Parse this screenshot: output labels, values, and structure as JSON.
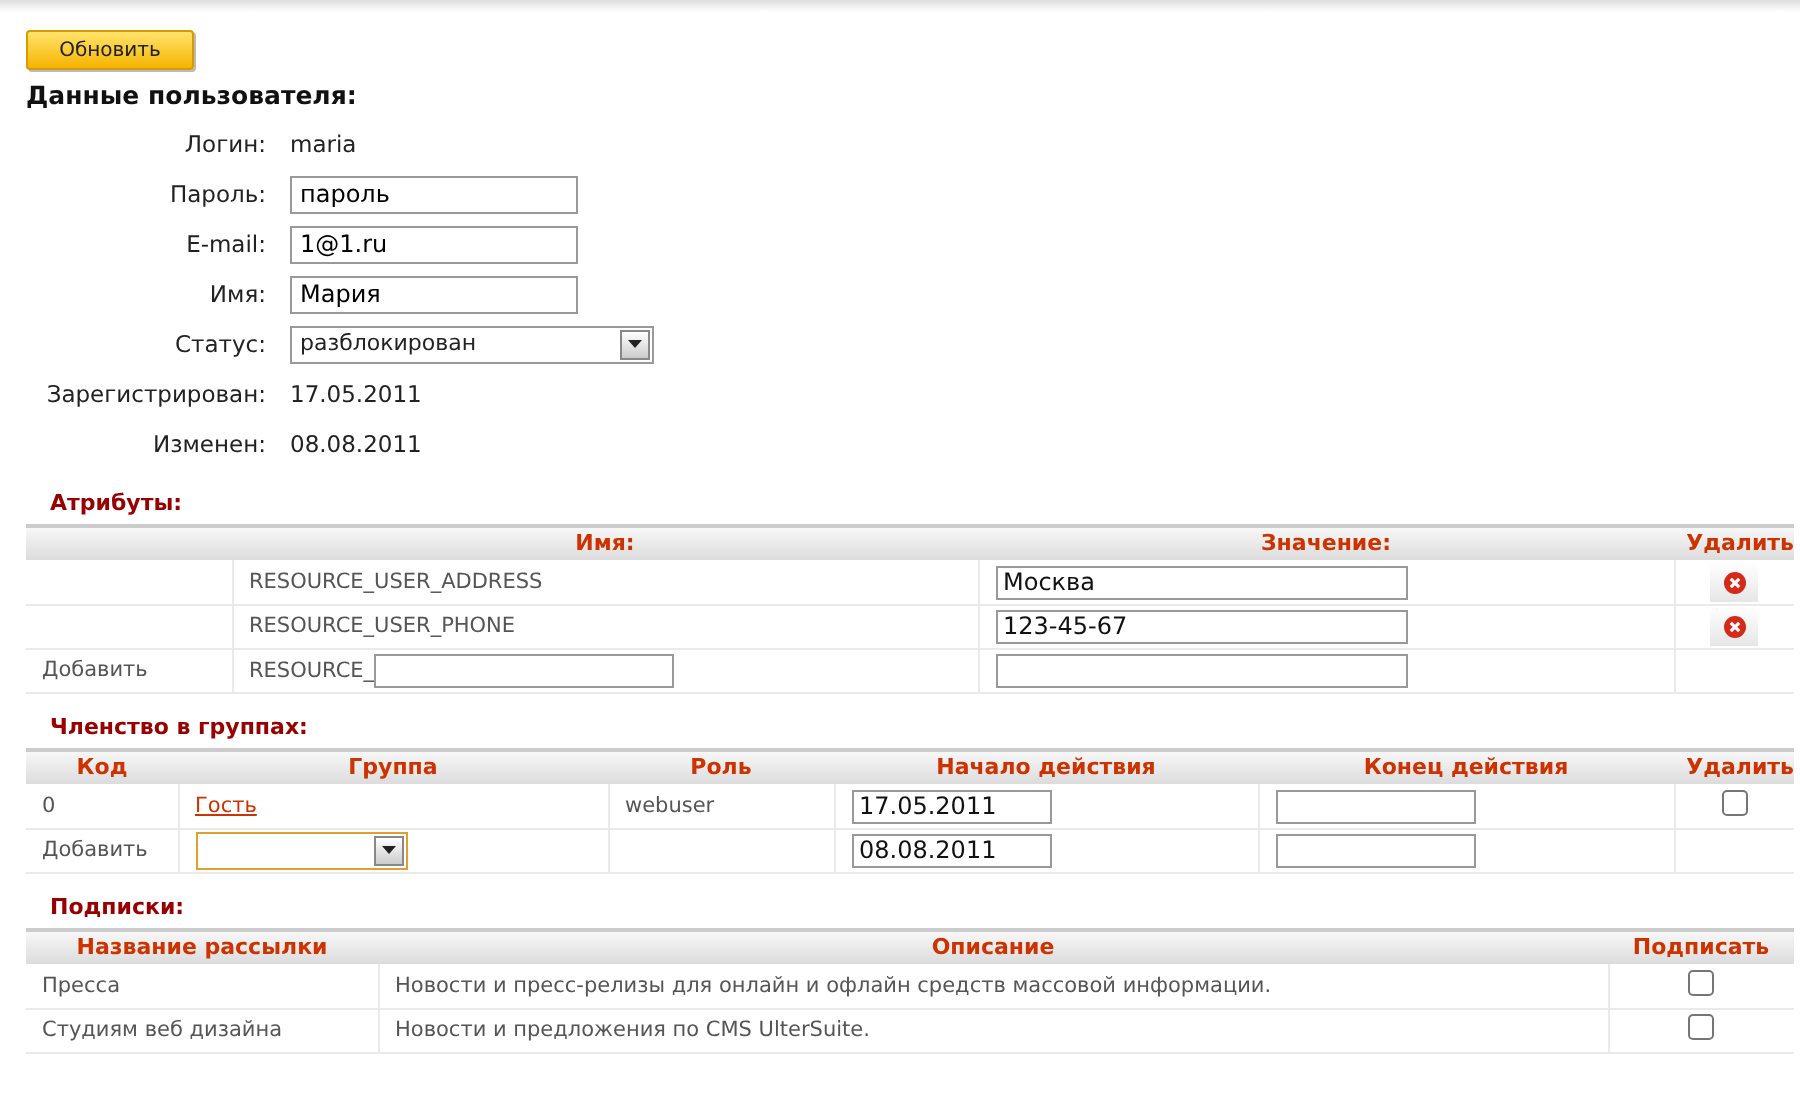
{
  "refresh_button": "Обновить",
  "user_section": {
    "title": "Данные пользователя:",
    "fields": [
      {
        "kind": "text",
        "label": "Логин:",
        "value": "maria"
      },
      {
        "kind": "input",
        "label": "Пароль:",
        "value": "пароль"
      },
      {
        "kind": "input",
        "label": "E-mail:",
        "value": "1@1.ru"
      },
      {
        "kind": "input",
        "label": "Имя:",
        "value": "Мария"
      },
      {
        "kind": "select",
        "label": "Статус:",
        "value": "разблокирован"
      },
      {
        "kind": "text",
        "label": "Зарегистрирован:",
        "value": "17.05.2011"
      },
      {
        "kind": "text",
        "label": "Изменен:",
        "value": "08.08.2011"
      }
    ]
  },
  "attributes": {
    "title": "Атрибуты:",
    "columns": [
      "Имя:",
      "Значение:",
      "Удалить"
    ],
    "rows": [
      {
        "name": "RESOURCE_USER_ADDRESS",
        "value": "Москва"
      },
      {
        "name": "RESOURCE_USER_PHONE",
        "value": "123-45-67"
      }
    ],
    "add_row": {
      "label": "Добавить",
      "prefix": "RESOURCE_"
    }
  },
  "groups": {
    "title": "Членство в группах:",
    "columns": [
      "Код",
      "Группа",
      "Роль",
      "Начало действия",
      "Конец действия",
      "Удалить"
    ],
    "rows": [
      {
        "code": "0",
        "group": "Гость",
        "role": "webuser",
        "start": "17.05.2011",
        "checked": false
      }
    ],
    "add_row": {
      "label": "Добавить",
      "start": "08.08.2011"
    }
  },
  "subscriptions": {
    "title": "Подписки:",
    "columns": [
      "Название рассылки",
      "Описание",
      "Подписать"
    ],
    "rows": [
      {
        "name": "Пресса",
        "description": "Новости и пресс-релизы для онлайн и офлайн средств массовой информации.",
        "checked": false
      },
      {
        "name": "Студиям веб дизайна",
        "description": "Новости и предложения по CMS UlterSuite.",
        "checked": false
      }
    ]
  }
}
